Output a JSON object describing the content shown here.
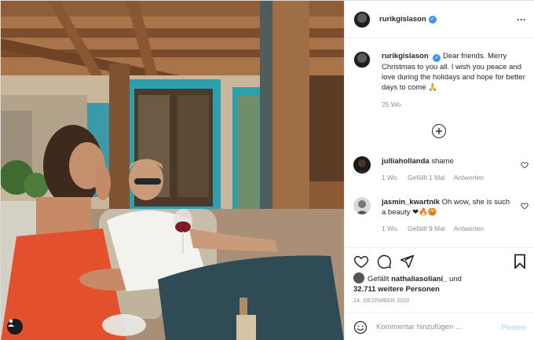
{
  "post": {
    "author": "rurikgislason",
    "verified": true
  },
  "caption": {
    "author": "rurikgislason",
    "text": "Dear friends. Merry Christmas to you all. I wish you peace and love during the holidays and hope for better days to come 🙏",
    "time": "25 Wo."
  },
  "comments": [
    {
      "author": "julliahollanda",
      "text": "shame",
      "time": "1 Wo.",
      "likes": "Gefällt 1 Mal",
      "reply": "Antworten"
    },
    {
      "author": "jasmin_kwartnik",
      "text": "Oh wow, she is such a beauty ❤🔥😡",
      "time": "1 Wo.",
      "likes": "Gefällt 9 Mal",
      "reply": "Antworten"
    }
  ],
  "likes": {
    "prefix": "Gefällt",
    "user": "nathaliasoliani_",
    "connector": "und",
    "count": "32.711 weitere Personen"
  },
  "date": "24. DEZEMBER 2020",
  "add_comment": {
    "placeholder": "Kommentar hinzufügen ...",
    "post_label": "Posten"
  },
  "colors": {
    "verified": "#3897f0",
    "post_button_disabled": "#b2dffc",
    "secondary_text": "#8e8e8e"
  },
  "icons": [
    "more-icon",
    "verified-icon",
    "load-more-icon",
    "heart-icon",
    "comment-icon",
    "share-icon",
    "bookmark-icon",
    "emoji-icon",
    "user-tag-icon"
  ]
}
